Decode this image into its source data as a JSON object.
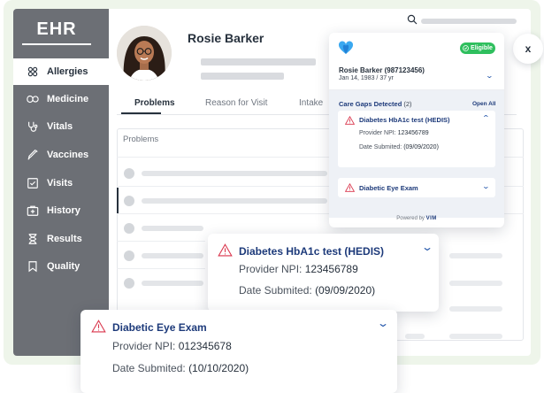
{
  "app": {
    "logo": "EHR"
  },
  "sidebar": {
    "items": [
      {
        "label": "Allergies",
        "icon": "allergies-icon",
        "active": true
      },
      {
        "label": "Medicine",
        "icon": "medicine-icon",
        "active": false
      },
      {
        "label": "Vitals",
        "icon": "stethoscope-icon",
        "active": false
      },
      {
        "label": "Vaccines",
        "icon": "syringe-icon",
        "active": false
      },
      {
        "label": "Visits",
        "icon": "checkbox-icon",
        "active": false
      },
      {
        "label": "History",
        "icon": "briefcase-medical-icon",
        "active": false
      },
      {
        "label": "Results",
        "icon": "hourglass-icon",
        "active": false
      },
      {
        "label": "Quality",
        "icon": "bookmark-icon",
        "active": false
      }
    ]
  },
  "patient": {
    "name": "Rosie Barker"
  },
  "tabs": [
    "Problems",
    "Reason for Visit",
    "Intake"
  ],
  "table": {
    "header": "Problems"
  },
  "vim": {
    "status": "Eligible",
    "patient_line": "Rosie Barker  (987123456)",
    "dob_line": "Jan 14, 1983  /  37 yr",
    "gaps_title": "Care Gaps Detected",
    "gaps_count": "(2)",
    "open_all": "Open All",
    "gap1": {
      "title": "Diabetes HbA1c test (HEDIS)",
      "npi_label": "Provider NPI:",
      "npi_value": "123456789",
      "date_label": "Date Submited:",
      "date_value": "(09/09/2020)"
    },
    "gap2": {
      "title": "Diabetic Eye Exam"
    },
    "powered_by": "Powered by",
    "brand": "VIM"
  },
  "overlay1": {
    "title": "Diabetes HbA1c test (HEDIS)",
    "npi_label": "Provider NPI:",
    "npi_value": "123456789",
    "date_label": "Date Submited:",
    "date_value": "(09/09/2020)"
  },
  "overlay2": {
    "title": "Diabetic Eye Exam",
    "npi_label": "Provider NPI:",
    "npi_value": "012345678",
    "date_label": "Date Submited:",
    "date_value": "(10/10/2020)"
  },
  "close_label": "x",
  "colors": {
    "sidebar": "#6c6f75",
    "accent": "#1d3a7a",
    "eligible": "#2fbf5e",
    "warning": "#d9334a",
    "brand_heart": "#3aa8f0"
  }
}
